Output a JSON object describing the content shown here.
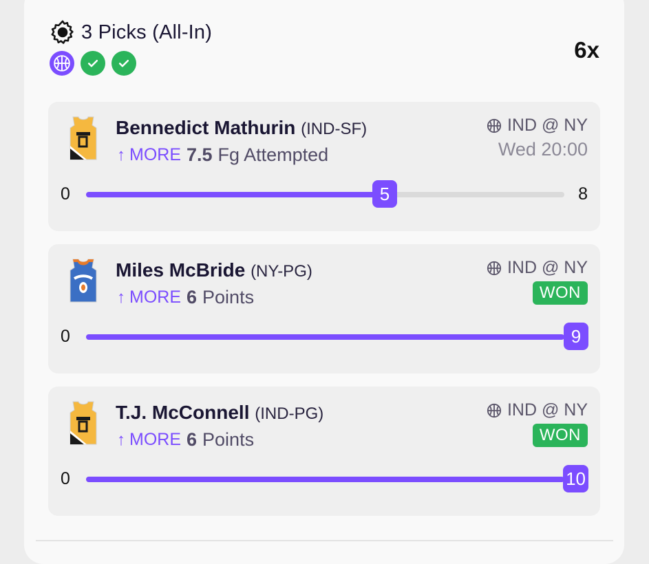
{
  "header": {
    "title": "3 Picks (All-In)",
    "multiplier": "6x",
    "badges": [
      "basketball-icon",
      "check-icon",
      "check-icon"
    ]
  },
  "colors": {
    "accent": "#7b4dff",
    "won": "#2bb45a"
  },
  "picks": [
    {
      "name": "Bennedict Mathurin",
      "team": "(IND-SF)",
      "direction": "MORE",
      "line_value": "7.5",
      "stat": "Fg Attempted",
      "matchup": "IND @ NY",
      "time": "Wed 20:00",
      "status": "",
      "min": "0",
      "max": "8",
      "current": "5",
      "progress": 0.625,
      "jersey": "IND"
    },
    {
      "name": "Miles McBride",
      "team": "(NY-PG)",
      "direction": "MORE",
      "line_value": "6",
      "stat": "Points",
      "matchup": "IND @ NY",
      "time": "",
      "status": "WON",
      "min": "0",
      "max": "9",
      "current": "9",
      "progress": 1.0,
      "jersey": "NY"
    },
    {
      "name": "T.J. McConnell",
      "team": "(IND-PG)",
      "direction": "MORE",
      "line_value": "6",
      "stat": "Points",
      "matchup": "IND @ NY",
      "time": "",
      "status": "WON",
      "min": "0",
      "max": "10",
      "current": "10",
      "progress": 1.0,
      "jersey": "IND"
    }
  ]
}
